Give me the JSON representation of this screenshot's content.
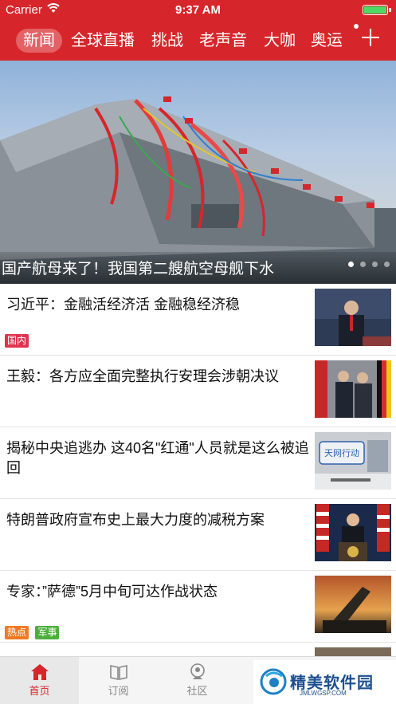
{
  "status_bar": {
    "carrier": "Carrier",
    "time": "9:37 AM"
  },
  "nav": {
    "tabs": [
      "新闻",
      "全球直播",
      "挑战",
      "老声音",
      "大咖",
      "奥运"
    ],
    "active_index": 0
  },
  "banner": {
    "caption": "国产航母来了！我国第二艘航空母舰下水",
    "page_count": 4,
    "active_page": 0
  },
  "news": [
    {
      "title": "习近平：金融活经济活 金融稳经济稳",
      "tags": [
        {
          "label": "国内",
          "color": "#e0334e"
        }
      ]
    },
    {
      "title": "王毅：各方应全面完整执行安理会涉朝决议",
      "tags": []
    },
    {
      "title": "揭秘中央追逃办 这40名\"红通\"人员就是这么被追回",
      "tags": []
    },
    {
      "title": "特朗普政府宣布史上最大力度的减税方案",
      "tags": []
    },
    {
      "title": "专家：”萨德”5月中旬可达作战状态",
      "tags": [
        {
          "label": "热点",
          "color": "#f47a20"
        },
        {
          "label": "军事",
          "color": "#4caf3c"
        }
      ]
    }
  ],
  "tabbar": [
    {
      "label": "首页",
      "icon": "home-icon",
      "active": true
    },
    {
      "label": "订阅",
      "icon": "book-icon",
      "active": false
    },
    {
      "label": "社区",
      "icon": "community-icon",
      "active": false
    }
  ],
  "watermark": {
    "text": "精美软件园",
    "sub": "JMLWGSP.COM"
  },
  "colors": {
    "brand_red": "#d7262b",
    "tab_active": "#d7262b",
    "tag_domestic": "#e0334e",
    "tag_hot": "#f47a20",
    "tag_military": "#4caf3c"
  }
}
